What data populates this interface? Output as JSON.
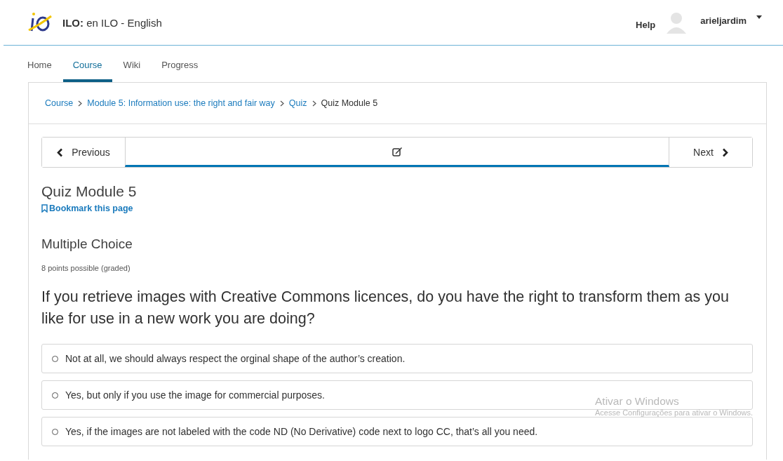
{
  "header": {
    "site_bold": "ILO:",
    "site_title": "en ILO - English",
    "help": "Help",
    "username": "arieljardim"
  },
  "tabs": [
    {
      "label": "Home",
      "selected": false
    },
    {
      "label": "Course",
      "selected": true
    },
    {
      "label": "Wiki",
      "selected": false
    },
    {
      "label": "Progress",
      "selected": false
    }
  ],
  "breadcrumb": [
    {
      "label": "Course",
      "link": true
    },
    {
      "label": "Module 5: Information use: the right and fair way",
      "link": true
    },
    {
      "label": "Quiz",
      "link": true
    },
    {
      "label": "Quiz Module 5",
      "link": false
    }
  ],
  "sequence_nav": {
    "previous": "Previous",
    "next": "Next"
  },
  "unit": {
    "title": "Quiz Module 5",
    "bookmark": "Bookmark this page"
  },
  "problem": {
    "heading": "Multiple Choice",
    "points": "8 points possible (graded)",
    "question": "If you retrieve images with Creative Commons licences, do you have the right to transform them as you like for use in a new work you are doing?",
    "options": [
      {
        "label": "Not at all, we should always respect the orginal shape of the author’s creation.",
        "selected": false
      },
      {
        "label": "Yes, but only if you use the image for commercial purposes.",
        "selected": false
      },
      {
        "label": "Yes, if the images are not labeled with the code ND (No Derivative) code next to logo CC, that’s all you need.",
        "selected": false
      }
    ]
  },
  "os_watermark": {
    "title": "Ativar o Windows",
    "subtitle": "Acesse Configurações para ativar o Windows."
  }
}
